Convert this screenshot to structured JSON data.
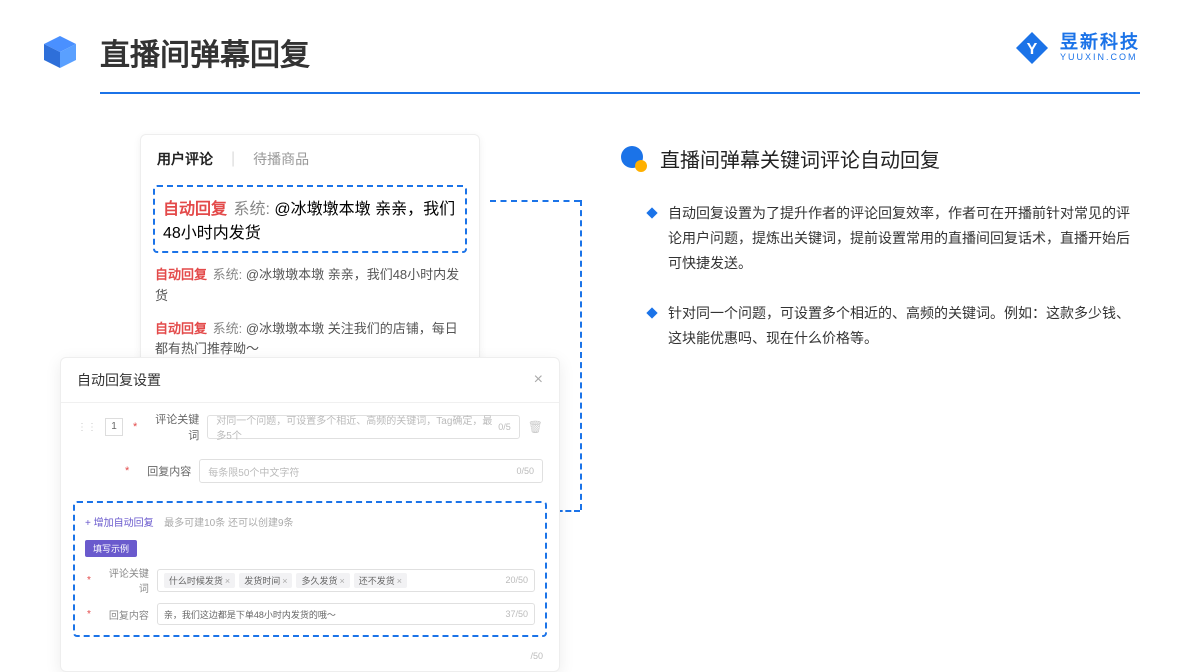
{
  "header": {
    "title": "直播间弹幕回复"
  },
  "brand": {
    "cn": "昱新科技",
    "en": "YUUXIN.COM"
  },
  "comments": {
    "tab_active": "用户评论",
    "tab_inactive": "待播商品",
    "highlight": {
      "tag": "自动回复",
      "sys": "系统:",
      "text": "@冰墩墩本墩 亲亲，我们48小时内发货"
    },
    "line2": {
      "tag": "自动回复",
      "sys": "系统:",
      "text": "@冰墩墩本墩 亲亲，我们48小时内发货"
    },
    "line3": {
      "tag": "自动回复",
      "sys": "系统:",
      "text": "@冰墩墩本墩 关注我们的店铺，每日都有热门推荐呦～"
    }
  },
  "settings": {
    "title": "自动回复设置",
    "num": "1",
    "kw_label": "评论关键词",
    "kw_ph": "对同一个问题，可设置多个相近、高频的关键词，Tag确定，最多5个",
    "kw_cnt": "0/5",
    "reply_label": "回复内容",
    "reply_ph": "每条限50个中文字符",
    "reply_cnt": "0/50",
    "add_label": "+ 增加自动回复",
    "add_hint": "最多可建10条 还可以创建9条",
    "pill": "填写示例",
    "ex_kw_label": "评论关键词",
    "chips": [
      "什么时候发货",
      "发货时间",
      "多久发货",
      "还不发货"
    ],
    "ex_kw_cnt": "20/50",
    "ex_reply_label": "回复内容",
    "ex_reply_text": "亲，我们这边都是下单48小时内发货的哦～",
    "ex_reply_cnt": "37/50",
    "outer_cnt": "/50"
  },
  "right": {
    "title": "直播间弹幕关键词评论自动回复",
    "b1": "自动回复设置为了提升作者的评论回复效率，作者可在开播前针对常见的评论用户问题，提炼出关键词，提前设置常用的直播间回复话术，直播开始后可快捷发送。",
    "b2": "针对同一个问题，可设置多个相近的、高频的关键词。例如：这款多少钱、这块能优惠吗、现在什么价格等。"
  }
}
